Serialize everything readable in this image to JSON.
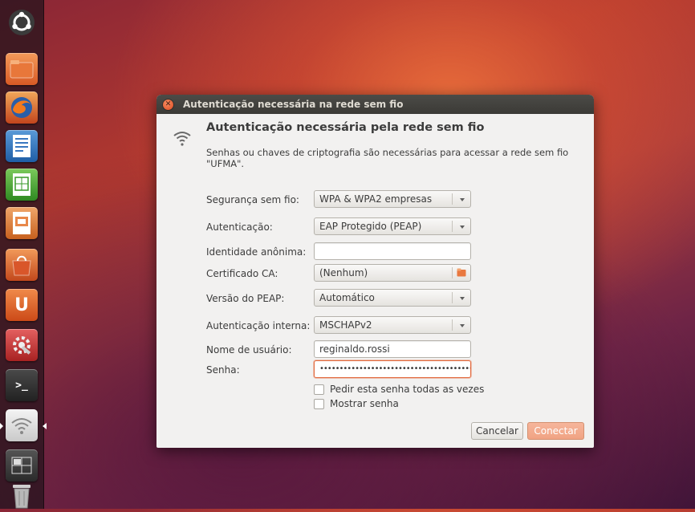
{
  "launcher": {
    "items": [
      {
        "name": "ubuntu-dash-icon"
      },
      {
        "name": "files-folder-icon"
      },
      {
        "name": "firefox-icon"
      },
      {
        "name": "libreoffice-writer-icon"
      },
      {
        "name": "libreoffice-calc-icon"
      },
      {
        "name": "libreoffice-impress-icon"
      },
      {
        "name": "software-center-icon"
      },
      {
        "name": "ubuntu-one-icon",
        "glyph": "U"
      },
      {
        "name": "system-settings-icon"
      },
      {
        "name": "terminal-icon",
        "glyph": ">_"
      },
      {
        "name": "network-wireless-icon"
      },
      {
        "name": "workspace-switcher-icon"
      },
      {
        "name": "trash-icon"
      }
    ]
  },
  "dialog": {
    "window_title": "Autenticação necessária na rede sem fio",
    "heading": "Autenticação necessária pela rede sem fio",
    "description": "Senhas ou chaves de criptografia são necessárias para acessar a rede sem fio \"UFMA\".",
    "fields": {
      "security_label": "Segurança sem fio:",
      "security_value": "WPA & WPA2 empresas",
      "auth_label": "Autenticação:",
      "auth_value": "EAP Protegido (PEAP)",
      "anon_label": "Identidade anônima:",
      "anon_value": "",
      "ca_label": "Certificado CA:",
      "ca_value": "(Nenhum)",
      "peap_label": "Versão do PEAP:",
      "peap_value": "Automático",
      "inner_label": "Autenticação interna:",
      "inner_value": "MSCHAPv2",
      "user_label": "Nome de usuário:",
      "user_value": "reginaldo.rossi",
      "pwd_label": "Senha:",
      "pwd_value": "•••••••••••••••••••••••••••••••••••••••••••"
    },
    "checkboxes": {
      "ask_always": "Pedir esta senha todas as vezes",
      "show_password": "Mostrar senha"
    },
    "buttons": {
      "cancel": "Cancelar",
      "connect": "Conectar"
    }
  },
  "colors": {
    "accent": "#f0a383",
    "titlebar": "#3c3b37",
    "dialog_bg": "#f2f1f0"
  }
}
